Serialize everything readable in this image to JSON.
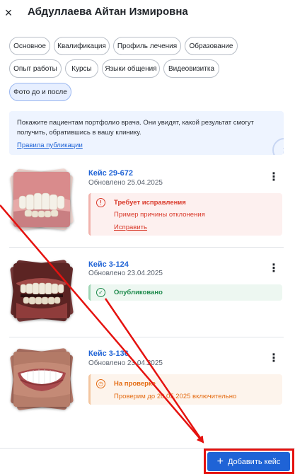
{
  "header": {
    "title": "Абдуллаева Айтан Измировна",
    "close_icon": "×"
  },
  "tabs": [
    {
      "label": "Основное"
    },
    {
      "label": "Квалификация"
    },
    {
      "label": "Профиль лечения"
    },
    {
      "label": "Образование"
    },
    {
      "label": "Опыт работы"
    },
    {
      "label": "Курсы"
    },
    {
      "label": "Языки общения"
    },
    {
      "label": "Видеовизитка"
    },
    {
      "label": "Фото до и после"
    }
  ],
  "active_tab": "Фото до и после",
  "info": {
    "text": "Покажите пациентам портфолио врача. Они увидят, какой результат смогут получить, обратившись в вашу клинику.",
    "link": "Правила публикации",
    "icon": "i"
  },
  "cases": [
    {
      "title": "Кейс 29-672",
      "updated": "Обновлено 25.04.2025",
      "more_icon": "⋮",
      "status": {
        "type": "error",
        "icon": "!",
        "title": "Требует исправления",
        "subtitle": "Пример причины отклонения",
        "link": "Исправить",
        "color": "#d93a2b"
      }
    },
    {
      "title": "Кейс 3-124",
      "updated": "Обновлено 23.04.2025",
      "more_icon": "⋮",
      "status": {
        "type": "ok",
        "icon": "✓",
        "title": "Опубликовано",
        "color": "#1e8a4c"
      }
    },
    {
      "title": "Кейс 3-136",
      "updated": "Обновлено 23.04.2025",
      "more_icon": "⋮",
      "status": {
        "type": "pending",
        "icon": "◷",
        "title": "На проверке",
        "subtitle": "Проверим до 20.05.2025 включительно",
        "color": "#e46b12"
      }
    }
  ],
  "footer": {
    "add_button_label": "Добавить кейс",
    "add_icon": "+"
  },
  "colors": {
    "accent": "#1f63d6",
    "annotation": "#e5120f"
  }
}
